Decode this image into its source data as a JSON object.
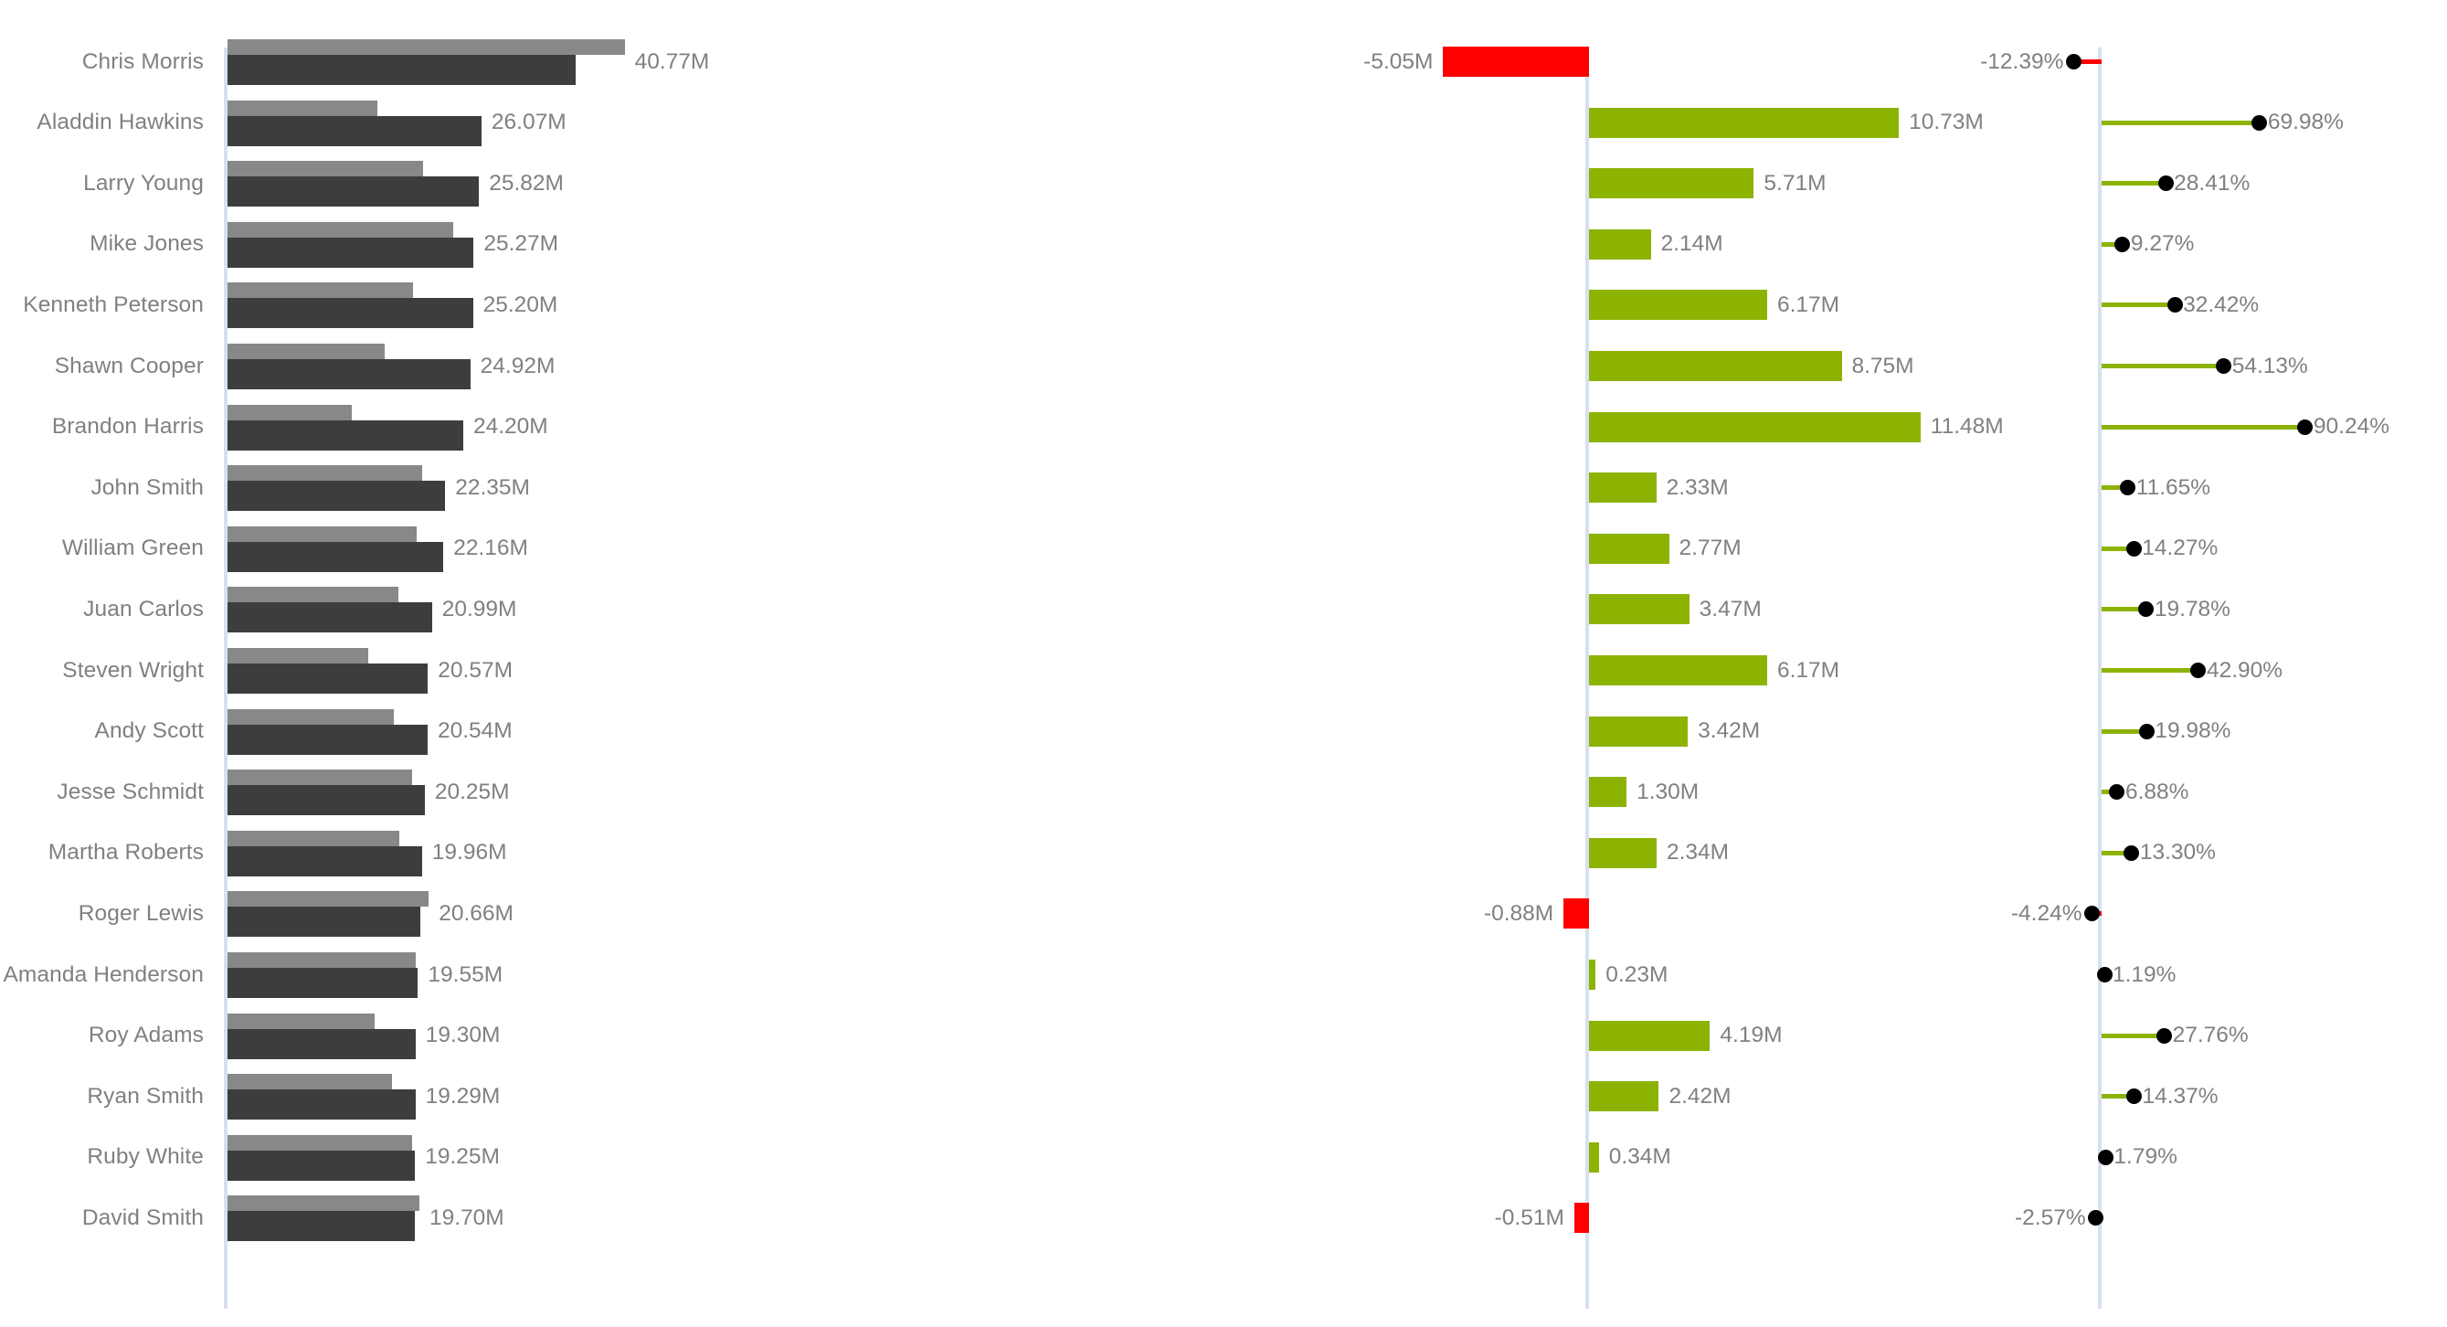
{
  "chart_data": {
    "type": "bar",
    "title": "",
    "subtitle": "",
    "xlabel": "",
    "ylabel": "",
    "legend": [],
    "grid": false,
    "layout": {
      "panels": [
        "category-labels",
        "actual-vs-plan-bars",
        "absolute-variance-bars",
        "relative-variance-lollipop"
      ],
      "orientation": "horizontal",
      "value_suffix": "M",
      "percent_suffix": "%",
      "bars_axis_max_m": 41,
      "variance_axis_range_m": [
        -6,
        12.5
      ],
      "percent_axis_range_pct": [
        -14,
        95
      ]
    },
    "colors": {
      "plan_bar": "#888888",
      "actual_bar": "#3d3d3d",
      "positive": "#8cb302",
      "negative": "#fe0000",
      "dot": "#000000",
      "axis": "#d6e0ef",
      "label_text": "#808080"
    },
    "categories": [
      "Chris Morris",
      "Aladdin Hawkins",
      "Larry Young",
      "Mike Jones",
      "Kenneth Peterson",
      "Shawn Cooper",
      "Brandon Harris",
      "John Smith",
      "William Green",
      "Juan Carlos",
      "Steven Wright",
      "Andy Scott",
      "Jesse Schmidt",
      "Martha Roberts",
      "Roger Lewis",
      "Amanda Henderson",
      "Roy Adams",
      "Ryan Smith",
      "Ruby White",
      "David Smith"
    ],
    "rows": [
      {
        "name": "Chris Morris",
        "actual": 35.72,
        "plan": 40.77,
        "bar_label": "40.77M",
        "variance": -5.05,
        "variance_label": "-5.05M",
        "percent": -12.39,
        "percent_label": "-12.39%"
      },
      {
        "name": "Aladdin Hawkins",
        "actual": 26.07,
        "plan": 15.34,
        "bar_label": "26.07M",
        "variance": 10.73,
        "variance_label": "10.73M",
        "percent": 69.98,
        "percent_label": "69.98%"
      },
      {
        "name": "Larry Young",
        "actual": 25.82,
        "plan": 20.11,
        "bar_label": "25.82M",
        "variance": 5.71,
        "variance_label": "5.71M",
        "percent": 28.41,
        "percent_label": "28.41%"
      },
      {
        "name": "Mike Jones",
        "actual": 25.27,
        "plan": 23.13,
        "bar_label": "25.27M",
        "variance": 2.14,
        "variance_label": "2.14M",
        "percent": 9.27,
        "percent_label": "9.27%"
      },
      {
        "name": "Kenneth Peterson",
        "actual": 25.2,
        "plan": 19.03,
        "bar_label": "25.20M",
        "variance": 6.17,
        "variance_label": "6.17M",
        "percent": 32.42,
        "percent_label": "32.42%"
      },
      {
        "name": "Shawn Cooper",
        "actual": 24.92,
        "plan": 16.17,
        "bar_label": "24.92M",
        "variance": 8.75,
        "variance_label": "8.75M",
        "percent": 54.13,
        "percent_label": "54.13%"
      },
      {
        "name": "Brandon Harris",
        "actual": 24.2,
        "plan": 12.72,
        "bar_label": "24.20M",
        "variance": 11.48,
        "variance_label": "11.48M",
        "percent": 90.24,
        "percent_label": "90.24%"
      },
      {
        "name": "John Smith",
        "actual": 22.35,
        "plan": 20.02,
        "bar_label": "22.35M",
        "variance": 2.33,
        "variance_label": "2.33M",
        "percent": 11.65,
        "percent_label": "11.65%"
      },
      {
        "name": "William Green",
        "actual": 22.16,
        "plan": 19.39,
        "bar_label": "22.16M",
        "variance": 2.77,
        "variance_label": "2.77M",
        "percent": 14.27,
        "percent_label": "14.27%"
      },
      {
        "name": "Juan Carlos",
        "actual": 20.99,
        "plan": 17.52,
        "bar_label": "20.99M",
        "variance": 3.47,
        "variance_label": "3.47M",
        "percent": 19.78,
        "percent_label": "19.78%"
      },
      {
        "name": "Steven Wright",
        "actual": 20.57,
        "plan": 14.4,
        "bar_label": "20.57M",
        "variance": 6.17,
        "variance_label": "6.17M",
        "percent": 42.9,
        "percent_label": "42.90%"
      },
      {
        "name": "Andy Scott",
        "actual": 20.54,
        "plan": 17.12,
        "bar_label": "20.54M",
        "variance": 3.42,
        "variance_label": "3.42M",
        "percent": 19.98,
        "percent_label": "19.98%"
      },
      {
        "name": "Jesse Schmidt",
        "actual": 20.25,
        "plan": 18.95,
        "bar_label": "20.25M",
        "variance": 1.3,
        "variance_label": "1.30M",
        "percent": 6.88,
        "percent_label": "6.88%"
      },
      {
        "name": "Martha Roberts",
        "actual": 19.96,
        "plan": 17.62,
        "bar_label": "19.96M",
        "variance": 2.34,
        "variance_label": "2.34M",
        "percent": 13.3,
        "percent_label": "13.30%"
      },
      {
        "name": "Roger Lewis",
        "actual": 19.78,
        "plan": 20.66,
        "bar_label": "20.66M",
        "variance": -0.88,
        "variance_label": "-0.88M",
        "percent": -4.24,
        "percent_label": "-4.24%"
      },
      {
        "name": "Amanda Henderson",
        "actual": 19.55,
        "plan": 19.32,
        "bar_label": "19.55M",
        "variance": 0.23,
        "variance_label": "0.23M",
        "percent": 1.19,
        "percent_label": "1.19%"
      },
      {
        "name": "Roy Adams",
        "actual": 19.3,
        "plan": 15.11,
        "bar_label": "19.30M",
        "variance": 4.19,
        "variance_label": "4.19M",
        "percent": 27.76,
        "percent_label": "27.76%"
      },
      {
        "name": "Ryan Smith",
        "actual": 19.29,
        "plan": 16.87,
        "bar_label": "19.29M",
        "variance": 2.42,
        "variance_label": "2.42M",
        "percent": 14.37,
        "percent_label": "14.37%"
      },
      {
        "name": "Ruby White",
        "actual": 19.25,
        "plan": 18.91,
        "bar_label": "19.25M",
        "variance": 0.34,
        "variance_label": "0.34M",
        "percent": 1.79,
        "percent_label": "1.79%"
      },
      {
        "name": "David Smith",
        "actual": 19.19,
        "plan": 19.7,
        "bar_label": "19.70M",
        "variance": -0.51,
        "variance_label": "-0.51M",
        "percent": -2.57,
        "percent_label": "-2.57%"
      }
    ]
  }
}
